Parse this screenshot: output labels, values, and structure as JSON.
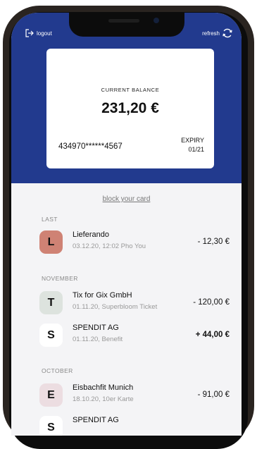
{
  "header": {
    "logout_label": "logout",
    "refresh_label": "refresh",
    "color": "#223a8e"
  },
  "card": {
    "balance_label": "CURRENT BALANCE",
    "balance_value": "231,20 €",
    "card_number": "434970******4567",
    "expiry_label": "EXPIRY",
    "expiry_value": "01/21"
  },
  "block_link": "block your card",
  "sections": [
    {
      "title": "LAST",
      "transactions": [
        {
          "letter": "L",
          "name": "Lieferando",
          "sub": "03.12.20, 12:02 Pho You",
          "amount": "- 12,30 €",
          "badge_color": "#cf8274",
          "icon": "letter-badge"
        }
      ]
    },
    {
      "title": "NOVEMBER",
      "transactions": [
        {
          "letter": "T",
          "name": "Tix for Gix GmbH",
          "sub": "01.11.20, Superbloom Ticket",
          "amount": "- 120,00 €",
          "badge_color": "#dde3de",
          "icon": "letter-badge"
        },
        {
          "letter": "S",
          "name": "SPENDIT AG",
          "sub": "01.11.20,  Benefit",
          "amount": "+ 44,00 €",
          "badge_color": "#ffffff",
          "icon": "letter-badge"
        }
      ]
    },
    {
      "title": "OCTOBER",
      "transactions": [
        {
          "letter": "E",
          "name": "Eisbachfit Munich",
          "sub": "18.10.20, 10er Karte",
          "amount": "- 91,00 €",
          "badge_color": "#ecdde1",
          "icon": "letter-badge"
        },
        {
          "letter": "S",
          "name": "SPENDIT AG",
          "sub": "",
          "amount": "",
          "badge_color": "#ffffff",
          "icon": "letter-badge"
        }
      ]
    }
  ]
}
